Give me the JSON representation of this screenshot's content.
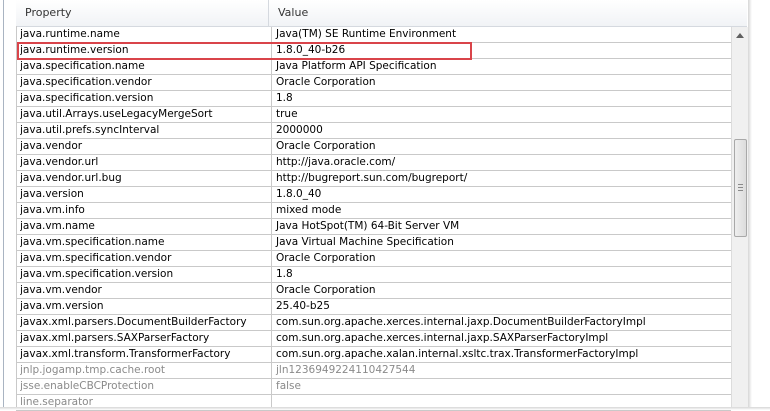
{
  "table": {
    "columns": {
      "property": "Property",
      "value": "Value"
    },
    "rows": [
      {
        "property": "java.runtime.name",
        "value": "Java(TM) SE Runtime Environment"
      },
      {
        "property": "java.runtime.version",
        "value": "1.8.0_40-b26"
      },
      {
        "property": "java.specification.name",
        "value": "Java Platform API Specification"
      },
      {
        "property": "java.specification.vendor",
        "value": "Oracle Corporation"
      },
      {
        "property": "java.specification.version",
        "value": "1.8"
      },
      {
        "property": "java.util.Arrays.useLegacyMergeSort",
        "value": "true"
      },
      {
        "property": "java.util.prefs.syncInterval",
        "value": "2000000"
      },
      {
        "property": "java.vendor",
        "value": "Oracle Corporation"
      },
      {
        "property": "java.vendor.url",
        "value": "http://java.oracle.com/"
      },
      {
        "property": "java.vendor.url.bug",
        "value": "http://bugreport.sun.com/bugreport/"
      },
      {
        "property": "java.version",
        "value": "1.8.0_40"
      },
      {
        "property": "java.vm.info",
        "value": "mixed mode"
      },
      {
        "property": "java.vm.name",
        "value": "Java HotSpot(TM) 64-Bit Server VM"
      },
      {
        "property": "java.vm.specification.name",
        "value": "Java Virtual Machine Specification"
      },
      {
        "property": "java.vm.specification.vendor",
        "value": "Oracle Corporation"
      },
      {
        "property": "java.vm.specification.version",
        "value": "1.8"
      },
      {
        "property": "java.vm.vendor",
        "value": "Oracle Corporation"
      },
      {
        "property": "java.vm.version",
        "value": "25.40-b25"
      },
      {
        "property": "javax.xml.parsers.DocumentBuilderFactory",
        "value": "com.sun.org.apache.xerces.internal.jaxp.DocumentBuilderFactoryImpl"
      },
      {
        "property": "javax.xml.parsers.SAXParserFactory",
        "value": "com.sun.org.apache.xerces.internal.jaxp.SAXParserFactoryImpl"
      },
      {
        "property": "javax.xml.transform.TransformerFactory",
        "value": "com.sun.org.apache.xalan.internal.xsltc.trax.TransformerFactoryImpl"
      },
      {
        "property": "jnlp.jogamp.tmp.cache.root",
        "value": "jln1236949224110427544",
        "dim": true
      },
      {
        "property": "jsse.enableCBCProtection",
        "value": "false",
        "dim": true
      },
      {
        "property": "line.separator",
        "value": "",
        "dim": true
      }
    ]
  },
  "highlighted_row": 1,
  "colors": {
    "highlight": "#d9444a",
    "grid": "#c9c9c9"
  }
}
